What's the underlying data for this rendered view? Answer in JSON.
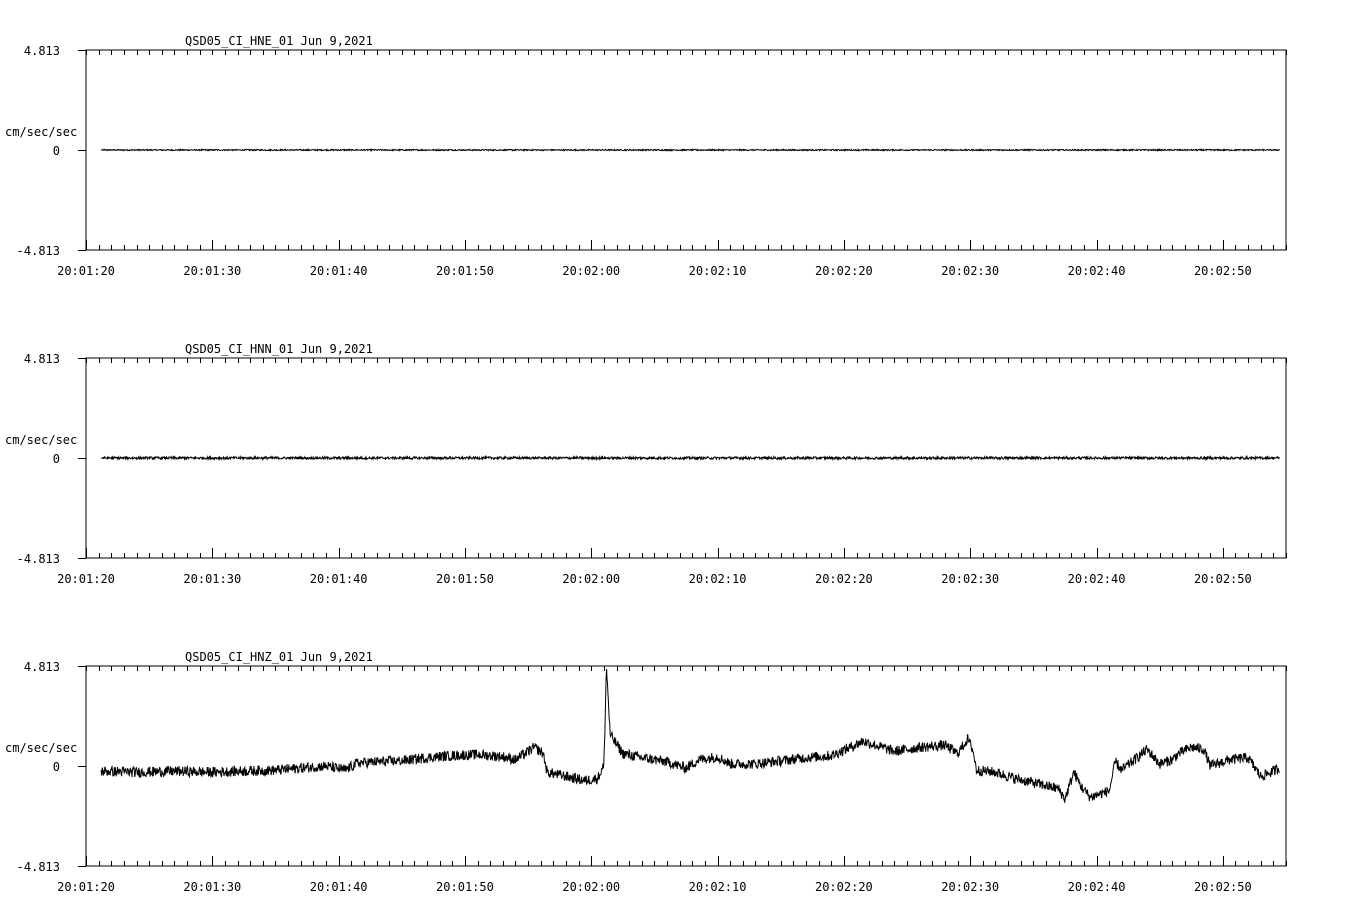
{
  "chart_data": [
    {
      "type": "line",
      "title": "QSD05_CI_HNE_01  Jun 9,2021",
      "ylabel": "cm/sec/sec",
      "ytick_labels": [
        "4.813",
        "0",
        "-4.813"
      ],
      "ylim": [
        -4.813,
        4.813
      ],
      "xlim_seconds": [
        80,
        175
      ],
      "xtick_labels": [
        "20:01:20",
        "20:01:30",
        "20:01:40",
        "20:01:50",
        "20:02:00",
        "20:02:10",
        "20:02:20",
        "20:02:30",
        "20:02:40",
        "20:02:50"
      ],
      "grid": false,
      "series": [
        {
          "x_range_seconds": [
            81.2,
            174.5
          ],
          "amplitude_profile": "flat",
          "noise_cm_s2": 0.03,
          "points": []
        }
      ]
    },
    {
      "type": "line",
      "title": "QSD05_CI_HNN_01  Jun 9,2021",
      "ylabel": "cm/sec/sec",
      "ytick_labels": [
        "4.813",
        "0",
        "-4.813"
      ],
      "ylim": [
        -4.813,
        4.813
      ],
      "xlim_seconds": [
        80,
        175
      ],
      "xtick_labels": [
        "20:01:20",
        "20:01:30",
        "20:01:40",
        "20:01:50",
        "20:02:00",
        "20:02:10",
        "20:02:20",
        "20:02:30",
        "20:02:40",
        "20:02:50"
      ],
      "grid": false,
      "series": [
        {
          "x_range_seconds": [
            81.2,
            174.5
          ],
          "amplitude_profile": "flat",
          "noise_cm_s2": 0.06,
          "points": []
        }
      ]
    },
    {
      "type": "line",
      "title": "QSD05_CI_HNZ_01  Jun 9,2021",
      "ylabel": "cm/sec/sec",
      "ytick_labels": [
        "4.813",
        "0",
        "-4.813"
      ],
      "ylim": [
        -4.813,
        4.813
      ],
      "xlim_seconds": [
        80,
        175
      ],
      "xtick_labels": [
        "20:01:20",
        "20:01:30",
        "20:01:40",
        "20:01:50",
        "20:02:00",
        "20:02:10",
        "20:02:20",
        "20:02:30",
        "20:02:40",
        "20:02:50"
      ],
      "grid": false,
      "series": [
        {
          "x_range_seconds": [
            81.2,
            174.5
          ],
          "noise_cm_s2": 0.25,
          "points": [
            [
              81.2,
              -0.25
            ],
            [
              84,
              -0.3
            ],
            [
              87,
              -0.25
            ],
            [
              90,
              -0.3
            ],
            [
              92,
              -0.25
            ],
            [
              95,
              -0.2
            ],
            [
              97,
              -0.1
            ],
            [
              99,
              0.0
            ],
            [
              100.5,
              -0.2
            ],
            [
              101.5,
              0.15
            ],
            [
              103,
              0.2
            ],
            [
              105,
              0.25
            ],
            [
              107,
              0.4
            ],
            [
              109,
              0.5
            ],
            [
              111,
              0.55
            ],
            [
              113,
              0.45
            ],
            [
              114,
              0.3
            ],
            [
              115.5,
              0.9
            ],
            [
              116.2,
              0.6
            ],
            [
              116.5,
              -0.3
            ],
            [
              118,
              -0.5
            ],
            [
              119.5,
              -0.7
            ],
            [
              120.5,
              -0.6
            ],
            [
              121.0,
              0.0
            ],
            [
              121.2,
              4.813
            ],
            [
              121.5,
              1.5
            ],
            [
              122.5,
              0.6
            ],
            [
              124,
              0.4
            ],
            [
              126,
              0.2
            ],
            [
              127.5,
              -0.1
            ],
            [
              128.5,
              0.3
            ],
            [
              130,
              0.45
            ],
            [
              131,
              0.1
            ],
            [
              133,
              0.1
            ],
            [
              135,
              0.25
            ],
            [
              137,
              0.4
            ],
            [
              139,
              0.5
            ],
            [
              140.5,
              0.9
            ],
            [
              141.5,
              1.2
            ],
            [
              142.5,
              1.0
            ],
            [
              144,
              0.7
            ],
            [
              146,
              0.9
            ],
            [
              148,
              1.0
            ],
            [
              149,
              0.6
            ],
            [
              149.8,
              1.3
            ],
            [
              150.2,
              0.8
            ],
            [
              150.5,
              -0.2
            ],
            [
              152,
              -0.3
            ],
            [
              153.5,
              -0.6
            ],
            [
              155,
              -0.8
            ],
            [
              157,
              -1.1
            ],
            [
              157.5,
              -1.6
            ],
            [
              158.2,
              -0.3
            ],
            [
              158.8,
              -1.0
            ],
            [
              159.5,
              -1.5
            ],
            [
              161,
              -1.2
            ],
            [
              161.5,
              0.2
            ],
            [
              162,
              -0.2
            ],
            [
              163,
              0.3
            ],
            [
              164,
              0.8
            ],
            [
              165,
              0.1
            ],
            [
              166,
              0.3
            ],
            [
              166.5,
              0.6
            ],
            [
              167.5,
              0.9
            ],
            [
              168.5,
              0.8
            ],
            [
              169,
              0.0
            ],
            [
              170.5,
              0.3
            ],
            [
              172,
              0.4
            ],
            [
              173,
              -0.5
            ],
            [
              173.8,
              -0.3
            ],
            [
              174.5,
              -0.1
            ]
          ]
        }
      ]
    }
  ]
}
